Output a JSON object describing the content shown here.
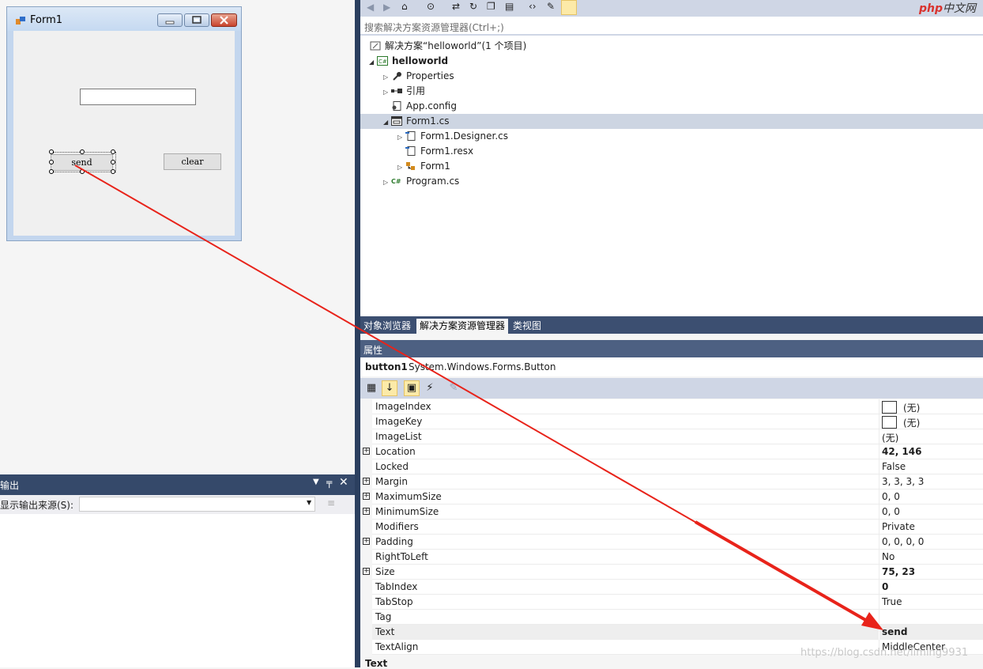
{
  "form": {
    "title": "Form1",
    "send_label": "send",
    "clear_label": "clear"
  },
  "output": {
    "title": "输出",
    "source_label": "显示输出来源(S):",
    "source_value": ""
  },
  "solution": {
    "search_placeholder": "搜索解决方案资源管理器(Ctrl+;)",
    "items": [
      {
        "label": "解决方案“helloworld”(1 个项目)"
      },
      {
        "label": "helloworld"
      },
      {
        "label": "Properties"
      },
      {
        "label": "引用"
      },
      {
        "label": "App.config"
      },
      {
        "label": "Form1.cs"
      },
      {
        "label": "Form1.Designer.cs"
      },
      {
        "label": "Form1.resx"
      },
      {
        "label": "Form1"
      },
      {
        "label": "Program.cs"
      }
    ]
  },
  "tabs": [
    "对象浏览器",
    "解决方案资源管理器",
    "类视图"
  ],
  "properties": {
    "title": "属性",
    "object_name": "button1",
    "object_type": "System.Windows.Forms.Button",
    "rows": [
      {
        "name": "ImageIndex",
        "value": "(无)"
      },
      {
        "name": "ImageKey",
        "value": "(无)"
      },
      {
        "name": "ImageList",
        "value": "(无)"
      },
      {
        "name": "Location",
        "value": "42, 146"
      },
      {
        "name": "Locked",
        "value": "False"
      },
      {
        "name": "Margin",
        "value": "3, 3, 3, 3"
      },
      {
        "name": "MaximumSize",
        "value": "0, 0"
      },
      {
        "name": "MinimumSize",
        "value": "0, 0"
      },
      {
        "name": "Modifiers",
        "value": "Private"
      },
      {
        "name": "Padding",
        "value": "0, 0, 0, 0"
      },
      {
        "name": "RightToLeft",
        "value": "No"
      },
      {
        "name": "Size",
        "value": "75, 23"
      },
      {
        "name": "TabIndex",
        "value": "0"
      },
      {
        "name": "TabStop",
        "value": "True"
      },
      {
        "name": "Tag",
        "value": ""
      },
      {
        "name": "Text",
        "value": "send"
      },
      {
        "name": "TextAlign",
        "value": "MiddleCenter"
      }
    ],
    "desc_title": "Text"
  },
  "branding": {
    "logo_php": "php",
    "logo_cn": "中文网",
    "watermark": "https://blog.csdn.net/liming9931"
  },
  "colors": {
    "arrow": "#e8231a",
    "accent": "#35496a"
  }
}
